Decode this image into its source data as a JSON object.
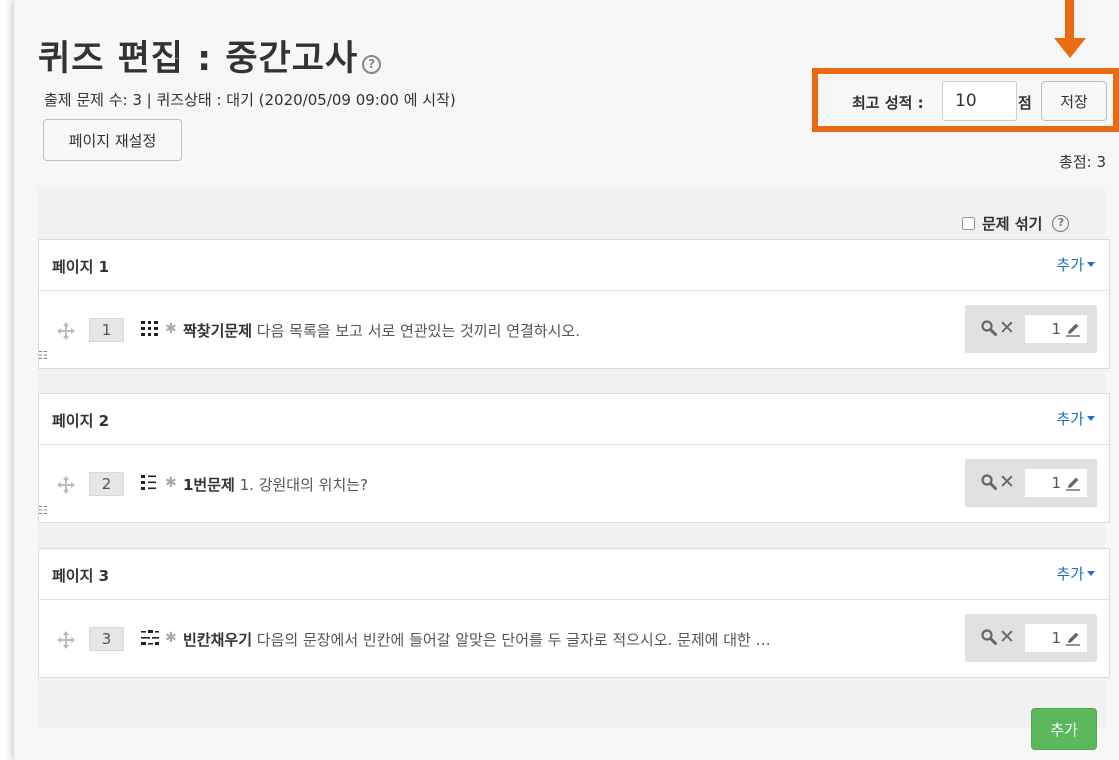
{
  "header": {
    "title": "퀴즈 편집 : 중간고사",
    "help_icon": "?",
    "quiz_info": "출제 문제 수: 3 | 퀴즈상태 : 대기 (2020/05/09 09:00 에 시작)",
    "repaginate_label": "페이지 재설정"
  },
  "maxgrade": {
    "label": "최고 성적 :",
    "value": "10",
    "unit": "점",
    "save_label": "저장"
  },
  "total_marks": "총점: 3",
  "shuffle": {
    "label": "문제 섞기",
    "help_icon": "?"
  },
  "colors": {
    "highlight": "#ec6a12",
    "link": "#1a73c4",
    "add_button": "#5cb85c"
  },
  "pages": [
    {
      "title": "페이지 1",
      "add_label": "추가",
      "question": {
        "slot": "1",
        "type_icon": "matching-icon",
        "name": "짝찾기문제",
        "text": " 다음 목록을 보고 서로 연관있는 것끼리 연결하시오.",
        "mark": "1"
      },
      "page_break_icon": "☷"
    },
    {
      "title": "페이지 2",
      "add_label": "추가",
      "question": {
        "slot": "2",
        "type_icon": "multichoice-icon",
        "name": "1번문제",
        "text": " 1. 강원대의 위치는?",
        "mark": "1"
      },
      "page_break_icon": "☷"
    },
    {
      "title": "페이지 3",
      "add_label": "추가",
      "question": {
        "slot": "3",
        "type_icon": "gapfill-icon",
        "name": "빈칸채우기",
        "text": " 다음의 문장에서 빈칸에 들어갈 알맞은 단어를 두 글자로 적으시오. 문제에 대한 …",
        "mark": "1"
      }
    }
  ],
  "add_button_label": "추가"
}
